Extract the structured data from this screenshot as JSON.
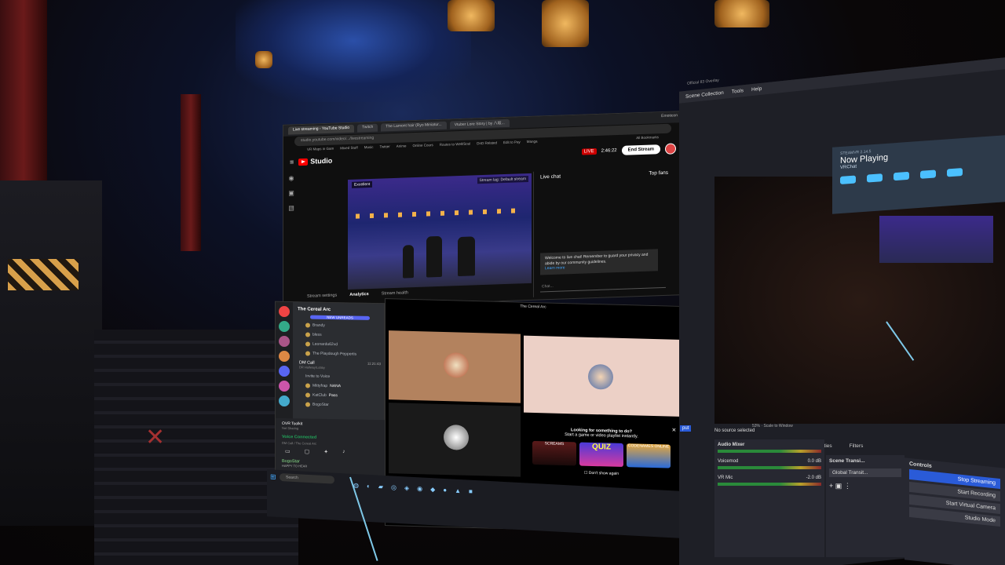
{
  "youtube": {
    "tabs": [
      "Live streaming - YouTube Studio",
      "Twitch",
      "The Lamont hair (Ryo Miniatur...",
      "Vtuber Lore Story | by 八坂..."
    ],
    "extra_tab": "Emoticon",
    "url": "studio.youtube.com/video/.../livestreaming",
    "bookmarks": [
      "VR Maps in Gam",
      "Mixed Stuff",
      "Music",
      "Twitter",
      "Anime",
      "Online Cours",
      "Routes to Well/Soul",
      "DnD Related",
      "Edit to Pay",
      "Manga",
      "All Bookmarks"
    ],
    "studio_label": "Studio",
    "live_badge": "LIVE",
    "live_time": "2:46:22",
    "end_stream": "End Stream",
    "quality": "Excellent",
    "stream_delay": "Stream lag: Default stream",
    "bottom_tabs": [
      "Stream settings",
      "Analytics",
      "Stream health"
    ],
    "chat_title": "Live chat",
    "chat_filter": "Top fans",
    "chat_notice": "Welcome to live chat! Remember to guard your privacy and abide by our community guidelines.",
    "learn_more": "Learn more",
    "chat_placeholder": "Chat..."
  },
  "discord": {
    "server": "The Cereal Arc",
    "new_unreads": "NEW UNREADS",
    "channels": [
      "Brandy",
      "bless",
      "Leonardu62vd",
      "The Playdough Peppertis"
    ],
    "dm_call": "DM Call",
    "dm_call_sub": "DR Hallway/Lobby",
    "call_time": "11:21:43",
    "members": [
      "Invite to Voice",
      "Mittyfrap",
      "KatClub",
      "BogoStar"
    ],
    "member_tags": [
      "NANA",
      "Pass"
    ],
    "toolkit": "OVR Toolkit",
    "toolkit_sub": "Not Sharing",
    "voice_connected": "Voice Connected",
    "voice_sub": "DM Call / The Cereal Arc",
    "user": "BogoStar",
    "user_status": "HAPPY TO HEAR"
  },
  "call": {
    "title": "The Cereal Arc",
    "promo_line1": "Looking for something to do?",
    "promo_line2": "Start a game or video playlist instantly.",
    "promo_cards": [
      "SCREAMS",
      "QUIZ",
      "CODENAMES ONLINE"
    ],
    "dont_show": "Don't show again"
  },
  "taskbar": {
    "search": "Search"
  },
  "obs": {
    "menu": [
      "Scene Collection",
      "Tools",
      "Help"
    ],
    "title": "Official 83 Overlay",
    "no_source": "No source selected",
    "scale": "Scale to Window",
    "zoom": "53%",
    "tabs": [
      "Properties",
      "Filters"
    ],
    "audio_mixer": "Audio Mixer",
    "channels": [
      {
        "name": "Voicemod",
        "db": "0.0 dB"
      },
      {
        "name": "VR Mic",
        "db": "-2.0 dB"
      }
    ],
    "scene_transitions": "Scene Transi...",
    "global_transition": "Global Transit...",
    "controls": "Controls",
    "buttons": [
      "Stop Streaming",
      "Start Recording",
      "Start Virtual Camera",
      "Studio Mode"
    ],
    "sources_tag": "put"
  },
  "steamvr": {
    "version": "STEAMVR 2.14.5",
    "now_playing": "Now Playing",
    "game": "VRChat"
  }
}
